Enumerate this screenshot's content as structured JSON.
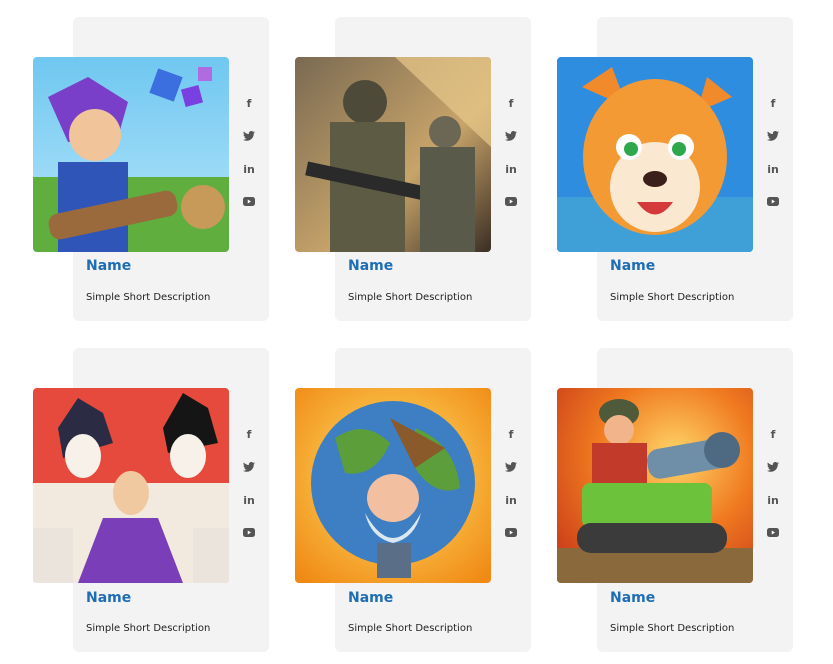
{
  "cards": [
    {
      "name": "Name",
      "description": "Simple Short Description",
      "image_icon": "cartoon-hero-with-bazooka-image"
    },
    {
      "name": "Name",
      "description": "Simple Short Description",
      "image_icon": "soldiers-with-rifles-image"
    },
    {
      "name": "Name",
      "description": "Simple Short Description",
      "image_icon": "cartoon-tiger-image"
    },
    {
      "name": "Name",
      "description": "Simple Short Description",
      "image_icon": "anime-characters-image"
    },
    {
      "name": "Name",
      "description": "Simple Short Description",
      "image_icon": "dwarf-miner-globe-image"
    },
    {
      "name": "Name",
      "description": "Simple Short Description",
      "image_icon": "cartoon-tank-soldier-image"
    }
  ],
  "social_links": [
    {
      "label": "f",
      "icon": "facebook-icon"
    },
    {
      "label": "twitter",
      "icon": "twitter-icon"
    },
    {
      "label": "in",
      "icon": "linkedin-icon"
    },
    {
      "label": "youtube",
      "icon": "youtube-icon"
    }
  ],
  "colors": {
    "card_bg": "#f3f3f3",
    "name": "#1f6db5",
    "icon": "#555555"
  }
}
